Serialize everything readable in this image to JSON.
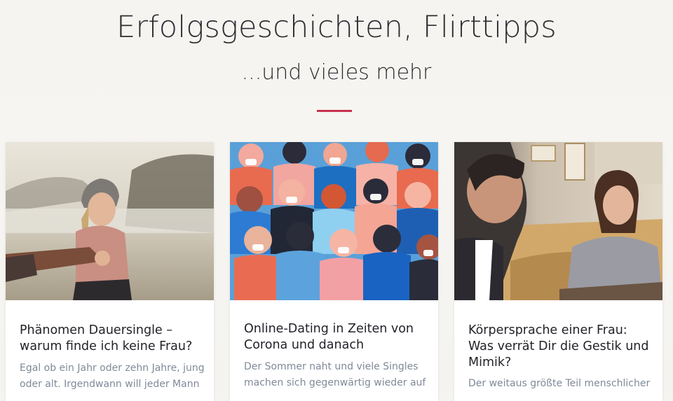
{
  "hero": {
    "title": "Erfolgsgeschichten, Flirttipps",
    "subtitle": "...und vieles mehr",
    "accent_color": "#c8314e"
  },
  "cards": [
    {
      "title": "Phänomen Dauersingle – warum finde ich keine Frau?",
      "excerpt": "Egal ob ein Jahr oder zehn Jahre, jung oder alt. Irgendwann will jeder Mann",
      "image": "woman-beach-holding-hand-photo"
    },
    {
      "title": "Online-Dating in Zeiten von Corona und danach",
      "excerpt": "Der Sommer naht und viele Singles machen sich gegenwärtig wieder auf",
      "image": "crowd-with-face-masks-illustration"
    },
    {
      "title": "Körpersprache einer Frau: Was verrät Dir die Gestik und Mimik?",
      "excerpt": "Der weitaus größte Teil menschlicher",
      "image": "couple-in-cafe-photo"
    }
  ]
}
